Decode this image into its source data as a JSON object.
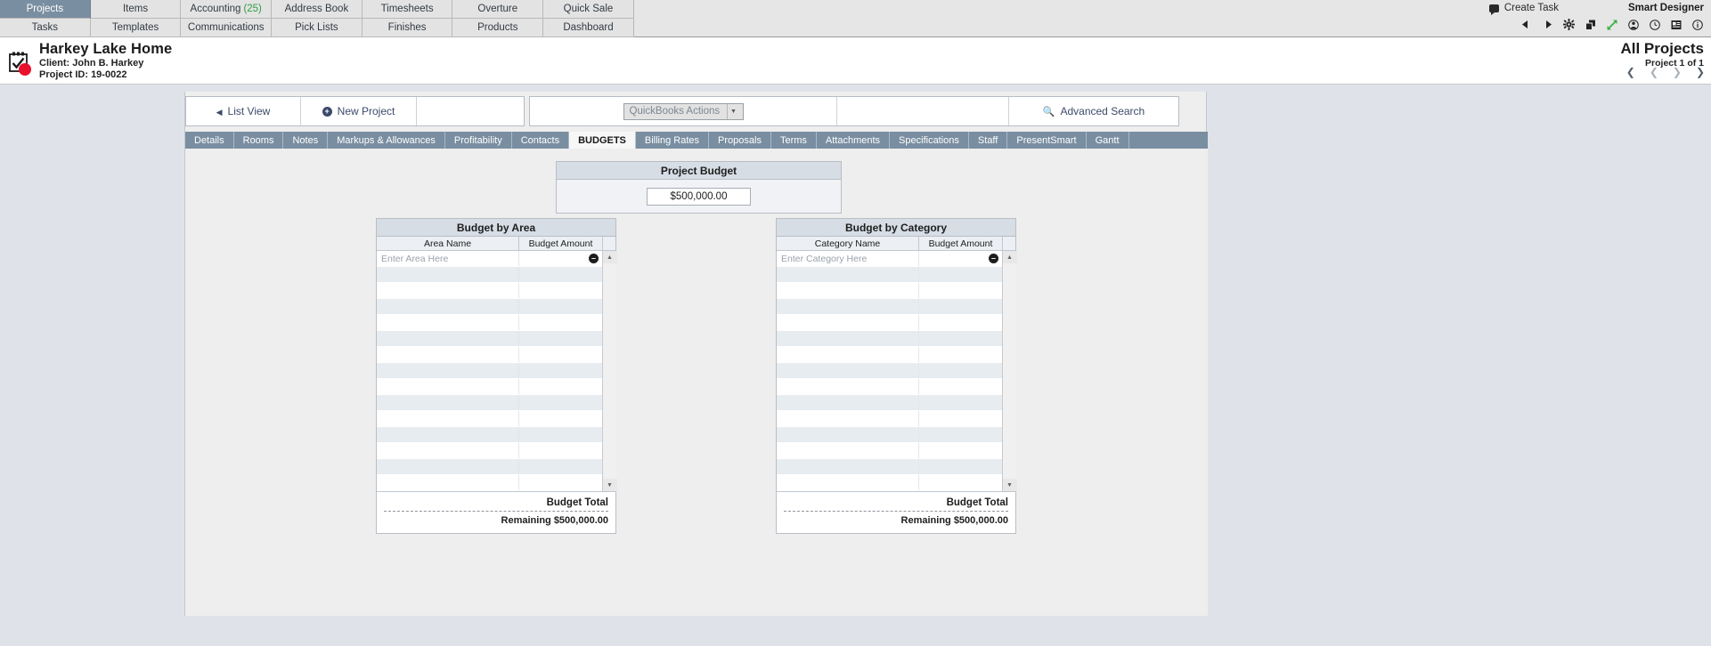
{
  "nav": {
    "row1": [
      {
        "label": "Projects",
        "active": true
      },
      {
        "label": "Items",
        "active": false
      },
      {
        "label": "Accounting",
        "count": "(25)",
        "active": false
      },
      {
        "label": "Address Book",
        "active": false
      },
      {
        "label": "Timesheets",
        "active": false
      },
      {
        "label": "Overture",
        "active": false
      },
      {
        "label": "Quick Sale",
        "active": false
      }
    ],
    "row2": [
      {
        "label": "Tasks"
      },
      {
        "label": "Templates"
      },
      {
        "label": "Communications"
      },
      {
        "label": "Pick Lists"
      },
      {
        "label": "Finishes"
      },
      {
        "label": "Products"
      },
      {
        "label": "Dashboard"
      }
    ]
  },
  "topright": {
    "create_task": "Create Task",
    "smart_designer": "Smart Designer",
    "icons": [
      "previous-arrow-icon",
      "next-arrow-icon",
      "gear-icon",
      "copy-icon",
      "expand-icon",
      "user-icon",
      "clock-icon",
      "notes-icon",
      "info-icon"
    ]
  },
  "project": {
    "name": "Harkey Lake Home",
    "client": "Client: John B. Harkey",
    "id": "Project ID: 19-0022",
    "scope_title": "All Projects",
    "scope_sub": "Project 1 of 1"
  },
  "toolbar": {
    "list_view": "List View",
    "new_project": "New Project",
    "quickbooks_actions": "QuickBooks Actions",
    "advanced_search": "Advanced Search"
  },
  "tabs": [
    {
      "label": "Details",
      "active": false
    },
    {
      "label": "Rooms",
      "active": false
    },
    {
      "label": "Notes",
      "active": false
    },
    {
      "label": "Markups & Allowances",
      "active": false
    },
    {
      "label": "Profitability",
      "active": false
    },
    {
      "label": "Contacts",
      "active": false
    },
    {
      "label": "BUDGETS",
      "active": true
    },
    {
      "label": "Billing Rates",
      "active": false
    },
    {
      "label": "Proposals",
      "active": false
    },
    {
      "label": "Terms",
      "active": false
    },
    {
      "label": "Attachments",
      "active": false
    },
    {
      "label": "Specifications",
      "active": false
    },
    {
      "label": "Staff",
      "active": false
    },
    {
      "label": "PresentSmart",
      "active": false
    },
    {
      "label": "Gantt",
      "active": false
    }
  ],
  "project_budget": {
    "title": "Project Budget",
    "amount": "$500,000.00"
  },
  "budget_by_area": {
    "title": "Budget by Area",
    "col_name": "Area Name",
    "col_amount": "Budget Amount",
    "placeholder": "Enter Area Here",
    "rows": [],
    "total_label": "Budget Total",
    "remaining_label": "Remaining $500,000.00"
  },
  "budget_by_category": {
    "title": "Budget by Category",
    "col_name": "Category Name",
    "col_amount": "Budget Amount",
    "placeholder": "Enter Category Here",
    "rows": [],
    "total_label": "Budget Total",
    "remaining_label": "Remaining $500,000.00"
  },
  "glyphs": {
    "minus": "–",
    "plus": "+",
    "up": "▲",
    "down": "▼"
  }
}
